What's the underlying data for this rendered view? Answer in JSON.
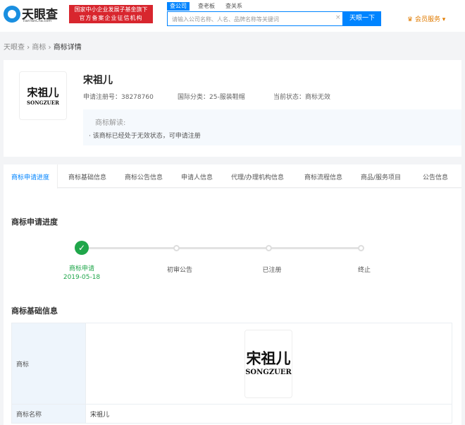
{
  "header": {
    "logo": "天眼查",
    "logo_sub": "TianYanCha.com",
    "badge_line1": "国家中小企业发展子基金旗下",
    "badge_line2": "官方备案企业征信机构",
    "search_tabs": [
      "查公司",
      "查老板",
      "查关系"
    ],
    "search_placeholder": "请输入公司名称、人名、品牌名称等关键词",
    "clear": "×",
    "search_button": "天眼一下",
    "member": "会员服务 ▾"
  },
  "breadcrumb": [
    "天眼查",
    "商标",
    "商标详情"
  ],
  "trademark": {
    "name": "宋祖儿",
    "logo_cn": "宋祖儿",
    "logo_en": "SONGZUER",
    "reg_no": "申请注册号：38278760",
    "class": "国际分类：25-服装鞋帽",
    "status": "当前状态：商标无效",
    "interp_title": "商标解读:",
    "interp_item": "该商标已经处于无效状态，可申请注册"
  },
  "tabs": [
    "商标申请进度",
    "商标基础信息",
    "商标公告信息",
    "申请人信息",
    "代理/办理机构信息",
    "商标流程信息",
    "商品/服务项目",
    "公告信息"
  ],
  "progress": {
    "title": "商标申请进度",
    "steps": [
      {
        "label": "商标申请",
        "date": "2019-05-18"
      },
      {
        "label": "初审公告"
      },
      {
        "label": "已注册"
      },
      {
        "label": "终止"
      }
    ]
  },
  "basic": {
    "title": "商标基础信息",
    "rows": [
      {
        "label": "商标"
      },
      {
        "label": "商标名称",
        "value": "宋祖儿"
      }
    ]
  }
}
